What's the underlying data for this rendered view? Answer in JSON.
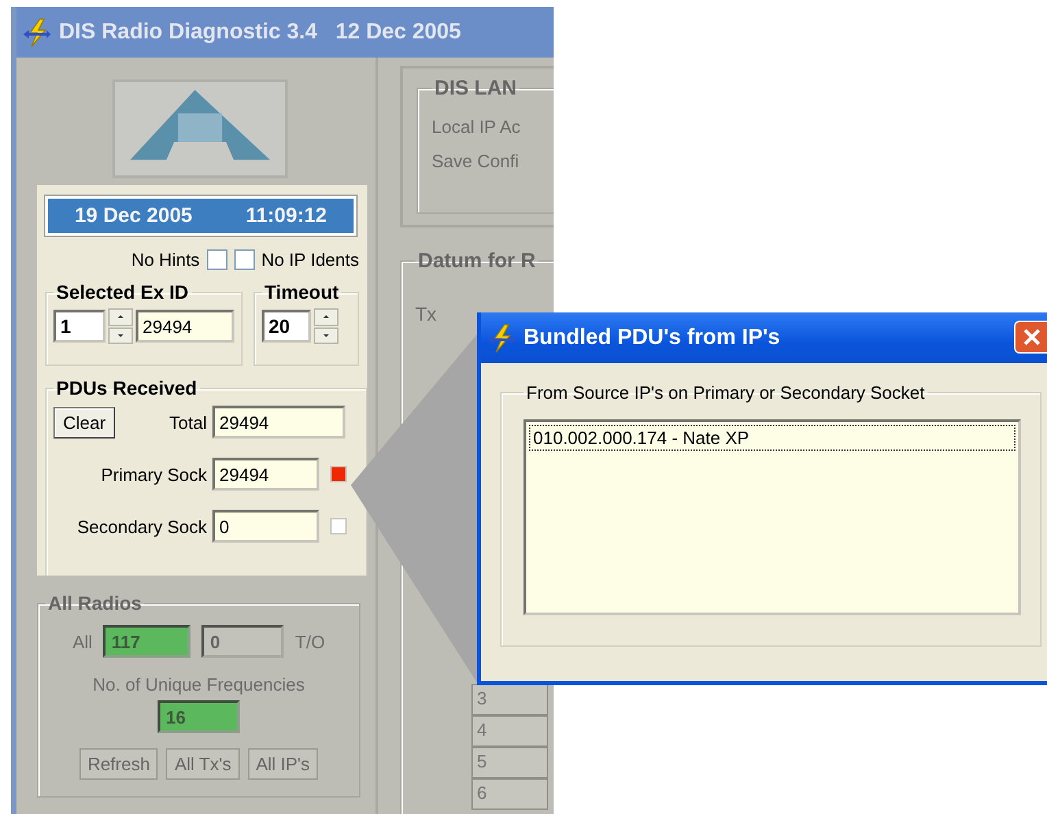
{
  "window": {
    "title": "DIS Radio Diagnostic 3.4   12 Dec 2005"
  },
  "clock": {
    "date": "19 Dec 2005",
    "time": "11:09:12"
  },
  "options": [
    {
      "label": "No Hints",
      "checked": false
    },
    {
      "label": "No IP Idents",
      "checked": false
    }
  ],
  "selected_ex_id": {
    "title": "Selected Ex ID",
    "spin_value": "1",
    "value": "29494"
  },
  "timeout": {
    "title": "Timeout",
    "value": "20"
  },
  "pdus_received": {
    "title": "PDUs Received",
    "clear_button": "Clear",
    "fields": [
      {
        "label": "Total",
        "value": "29494"
      },
      {
        "label": "Primary Sock",
        "value": "29494",
        "color": "#f02800"
      },
      {
        "label": "Secondary Sock",
        "value": "0",
        "color": "#ffffff"
      }
    ]
  },
  "all_radios": {
    "title": "All Radios",
    "all_label": "All",
    "all_value": "117",
    "timeout_value": "0",
    "timeout_label": "T/O",
    "unique_label": "No. of Unique Frequencies",
    "unique_value": "16",
    "buttons": [
      "Refresh",
      "All Tx's",
      "All IP's"
    ]
  },
  "right_panel": {
    "lan_group": {
      "title": "DIS LAN",
      "rows": [
        "Local IP Ac",
        "Save Confi"
      ]
    },
    "datum_group": {
      "title": "Datum for R",
      "label": "Tx",
      "row_numbers": [
        "3",
        "4",
        "5",
        "6"
      ]
    }
  },
  "dialog": {
    "title": "Bundled PDU's from IP's",
    "group_title": "From Source IP's on Primary or Secondary Socket",
    "items": [
      {
        "text": "010.002.000.174 - Nate XP",
        "selected": true
      }
    ]
  }
}
